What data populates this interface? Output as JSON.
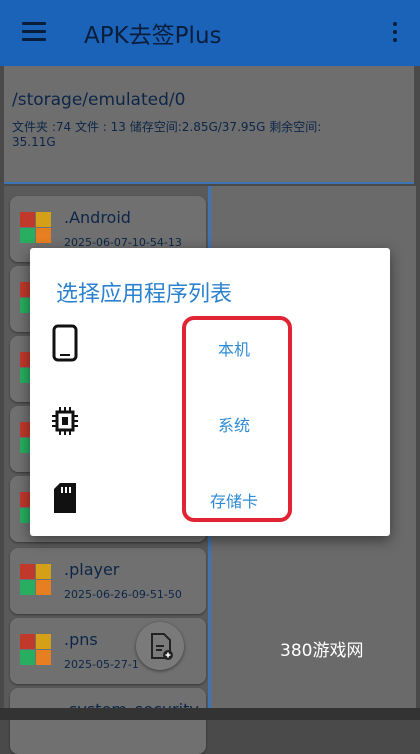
{
  "app": {
    "title": "APK去签Plus"
  },
  "info": {
    "path": "/storage/emulated/0",
    "stats_line1": "文件夹 :74    文件 :  13    储存空间:2.85G/37.95G  剩余空间:",
    "stats_line2": "35.11G"
  },
  "files": [
    {
      "name": ".Android",
      "date": "2025-06-07-10-54-13"
    },
    {
      "name": ".player",
      "date": "2025-06-26-09-51-50"
    },
    {
      "name": ".pns",
      "date": "2025-05-27-1"
    },
    {
      "name": ".system_security",
      "date": ""
    }
  ],
  "dialog": {
    "title": "选择应用程序列表",
    "options": [
      {
        "label": "本机",
        "icon": "phone-icon"
      },
      {
        "label": "系统",
        "icon": "chip-icon"
      },
      {
        "label": "存储卡",
        "icon": "sd-card-icon"
      }
    ]
  },
  "watermark": "380游戏网",
  "colors": {
    "primary": "#1b63b9",
    "dialog_text": "#2c82cf",
    "highlight": "#e02433"
  }
}
